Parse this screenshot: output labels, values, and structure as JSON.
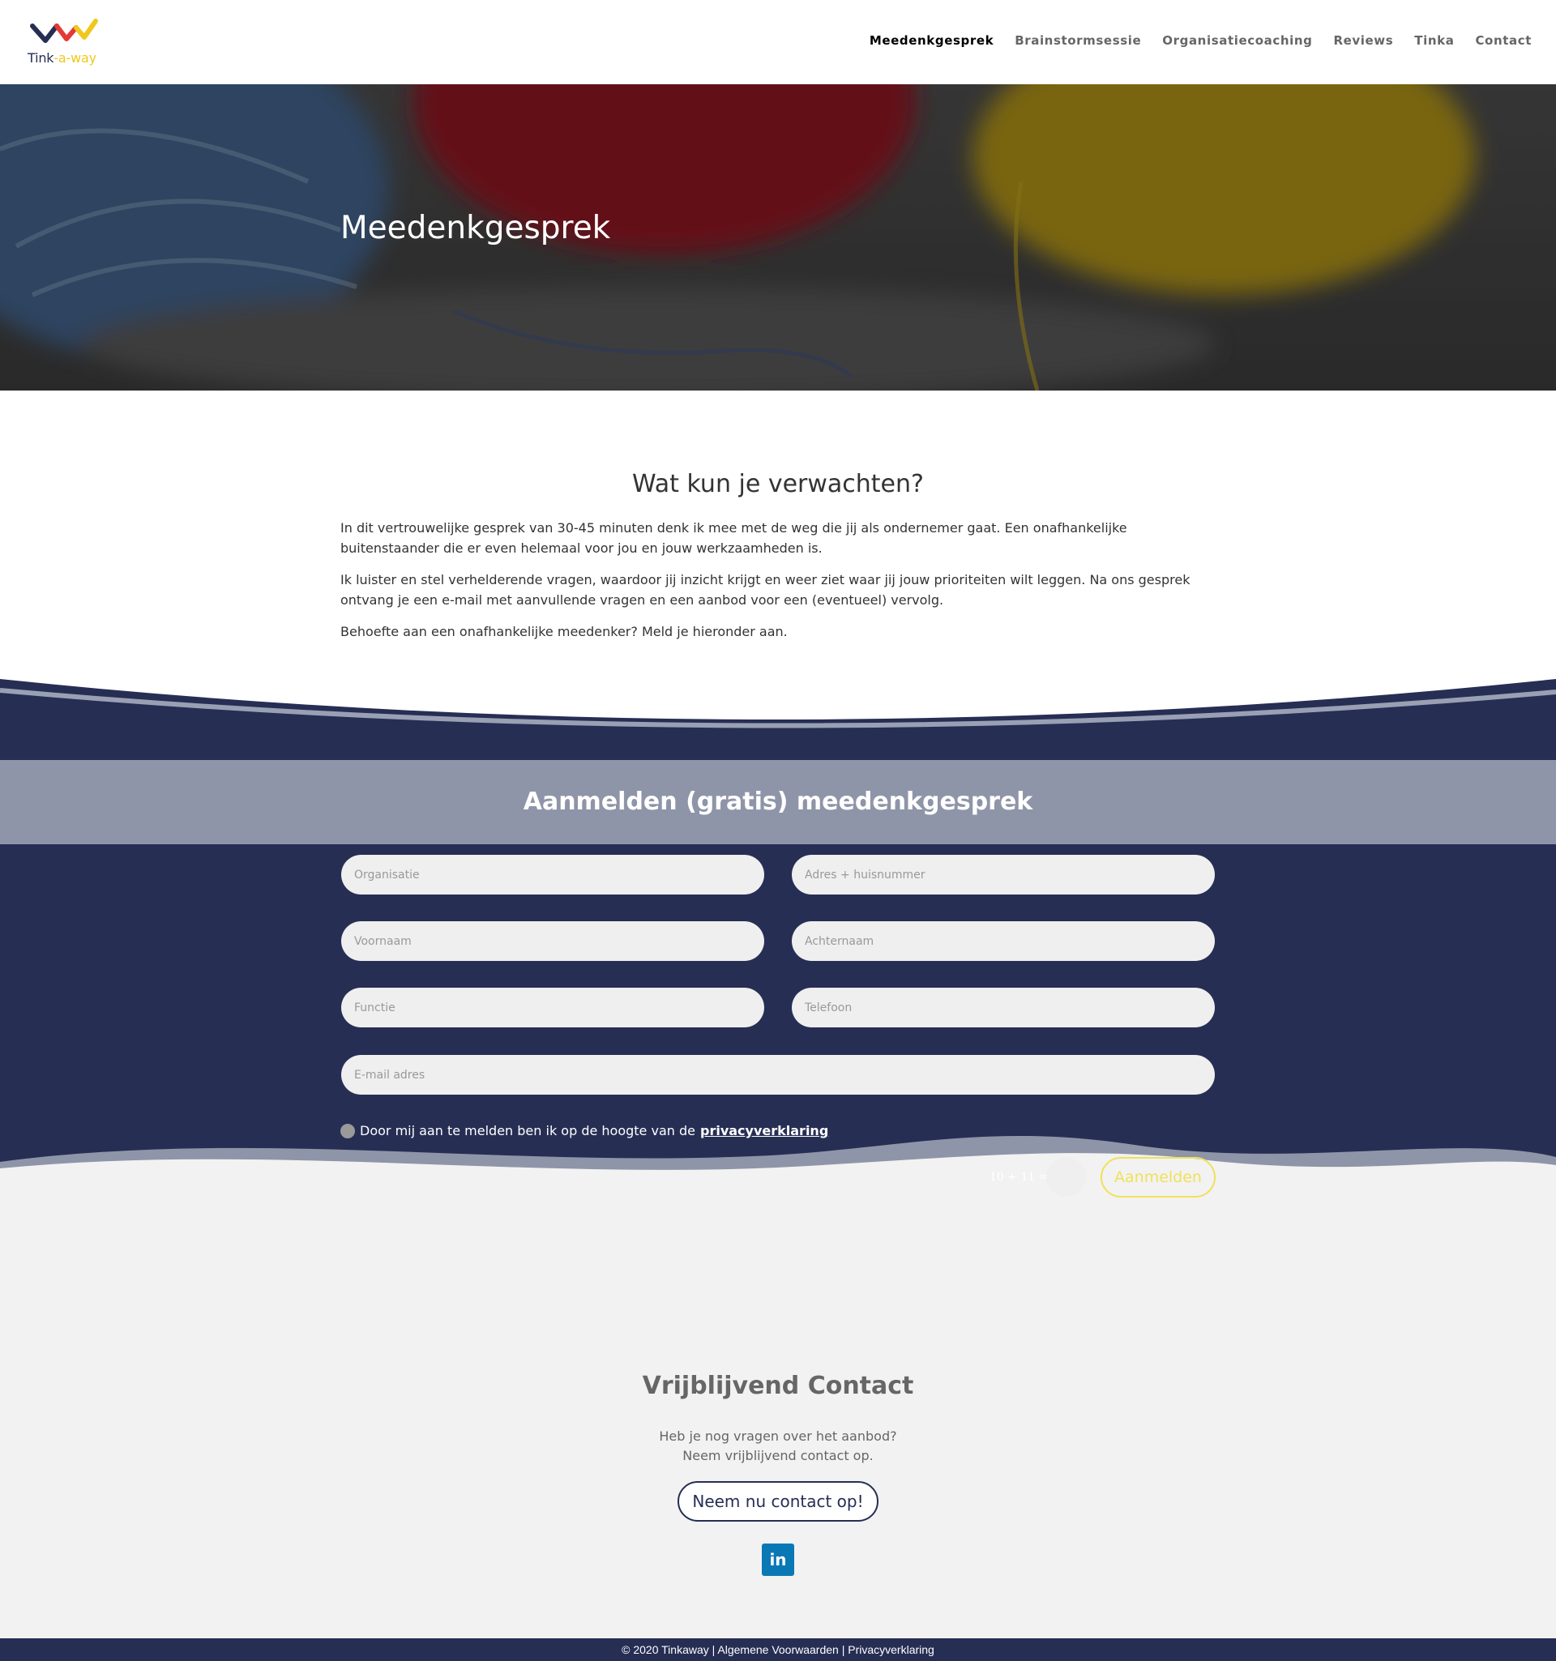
{
  "brand": {
    "logo_text_a": "Tink",
    "logo_text_b": "-a-way"
  },
  "nav": {
    "items": [
      "Meedenkgesprek",
      "Brainstormsessie",
      "Organisatiecoaching",
      "Reviews",
      "Tinka",
      "Contact"
    ]
  },
  "hero": {
    "title": "Meedenkgesprek"
  },
  "intro": {
    "heading": "Wat kun je verwachten?",
    "p1": "In dit vertrouwelijke gesprek van 30-45 minuten denk ik mee met de weg die jij als ondernemer gaat. Een onafhankelijke buitenstaander die er even helemaal voor jou en jouw werkzaamheden is.",
    "p2": "Ik luister en stel verhelderende vragen, waardoor jij inzicht krijgt en weer ziet waar jij jouw prioriteiten wilt leggen. Na ons gesprek ontvang je een e-mail met aanvullende vragen en een aanbod voor een (eventueel) vervolg.",
    "p3": "Behoefte aan een onafhankelijke meedenker? Meld je hieronder aan."
  },
  "form": {
    "heading": "Aanmelden (gratis) meedenkgesprek",
    "organisatie": "Organisatie",
    "adres": "Adres + huisnummer",
    "voornaam": "Voornaam",
    "achternaam": "Achternaam",
    "functie": "Functie",
    "telefoon": "Telefoon",
    "email": "E-mail adres",
    "consent_text": "Door mij aan te melden ben ik op de hoogte van de",
    "consent_link": "privacyverklaring",
    "captcha_label": "10 + 11 =",
    "submit": "Aanmelden"
  },
  "contact": {
    "heading": "Vrijblijvend Contact",
    "line1": "Heb je nog vragen over het aanbod?",
    "line2": "Neem vrijblijvend contact op.",
    "button": "Neem nu contact op!",
    "social_icon": "linkedin-icon",
    "social_label": "in"
  },
  "footer": {
    "text": "© 2020 Tinkaway | Algemene Voorwaarden | Privacyverklaring"
  },
  "colors": {
    "navy": "#262e54",
    "accent_yellow": "#f0e15a",
    "bar": "#8f95a8",
    "contact_bg": "#f2f2f2"
  }
}
